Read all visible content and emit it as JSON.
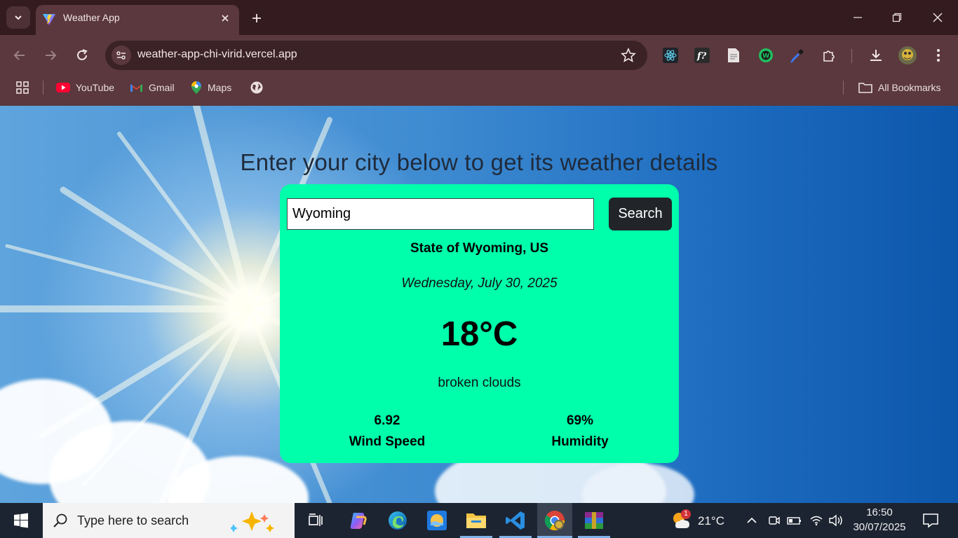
{
  "browser": {
    "tab_title": "Weather App",
    "url": "weather-app-chi-virid.vercel.app",
    "bookmarks": [
      {
        "label": "YouTube",
        "icon": "youtube-icon"
      },
      {
        "label": "Gmail",
        "icon": "gmail-icon"
      },
      {
        "label": "Maps",
        "icon": "maps-icon"
      }
    ],
    "all_bookmarks": "All Bookmarks"
  },
  "app": {
    "heading": "Enter your city below to get its weather details",
    "input_value": "Wyoming",
    "search_label": "Search",
    "location": "State of Wyoming, US",
    "date": "Wednesday, July 30, 2025",
    "temperature": "18°C",
    "description": "broken clouds",
    "wind": {
      "value": "6.92",
      "label": "Wind Speed"
    },
    "humidity": {
      "value": "69%",
      "label": "Humidity"
    },
    "card_color": "#00ffab"
  },
  "taskbar": {
    "search_placeholder": "Type here to search",
    "weather_temp": "21°C",
    "weather_badge": "1",
    "time": "16:50",
    "date": "30/07/2025"
  }
}
